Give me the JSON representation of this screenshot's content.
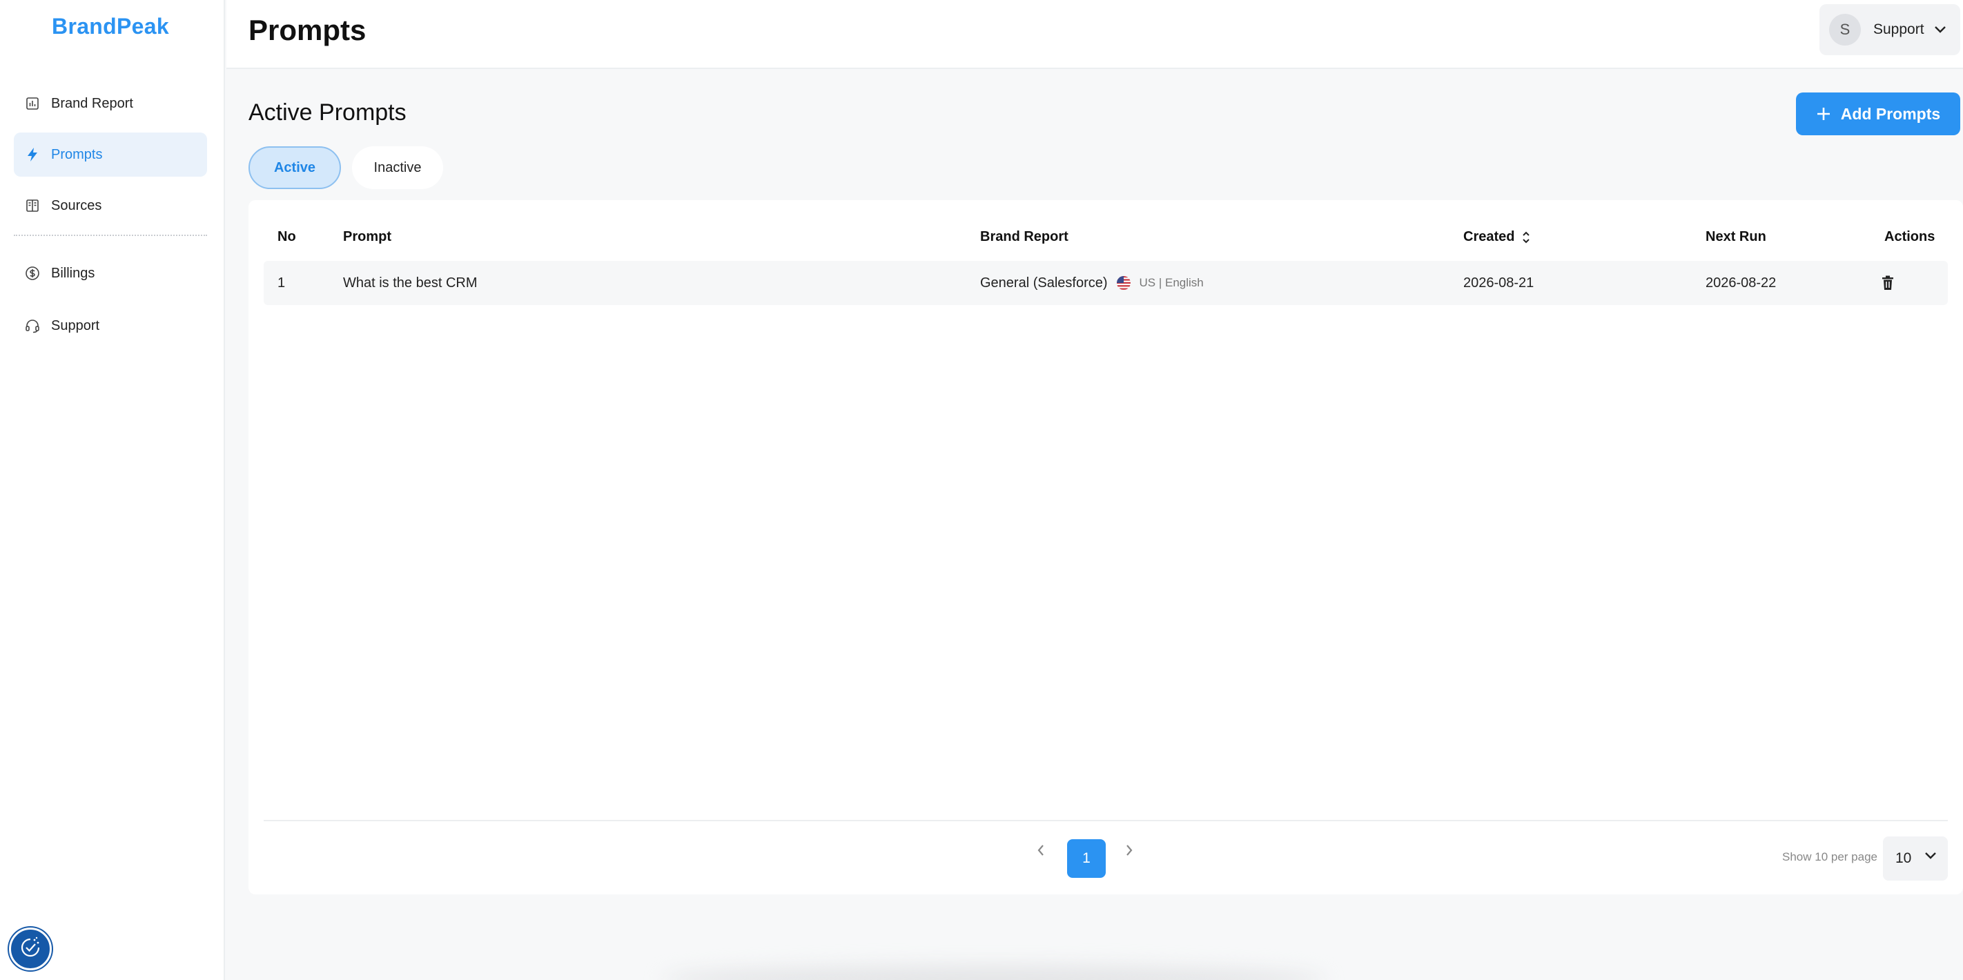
{
  "app": {
    "brand": "BrandPeak",
    "accent": "#2b93f2"
  },
  "sidebar": {
    "items": [
      {
        "label": "Brand Report",
        "icon": "bar-chart-icon"
      },
      {
        "label": "Prompts",
        "icon": "lightning-icon",
        "active": true
      },
      {
        "label": "Sources",
        "icon": "book-icon"
      },
      {
        "label": "Billings",
        "icon": "dollar-icon"
      },
      {
        "label": "Support",
        "icon": "headset-icon"
      }
    ]
  },
  "header": {
    "title": "Prompts",
    "user": {
      "initial": "S",
      "name": "Support"
    }
  },
  "main": {
    "section_title": "Active Prompts",
    "add_button": "Add Prompts",
    "tabs": [
      {
        "label": "Active",
        "active": true
      },
      {
        "label": "Inactive",
        "active": false
      }
    ],
    "table": {
      "columns": [
        "No",
        "Prompt",
        "Brand Report",
        "Created",
        "Next Run",
        "Actions"
      ],
      "rows": [
        {
          "no": "1",
          "prompt": "What is the best CRM",
          "brand_report": "General (Salesforce)",
          "locale": "US | English",
          "created": "2026-08-21",
          "next_run": "2026-08-22"
        }
      ]
    },
    "pagination": {
      "current_page": "1",
      "per_page_label": "Show 10 per page",
      "per_page_value": "10"
    }
  }
}
